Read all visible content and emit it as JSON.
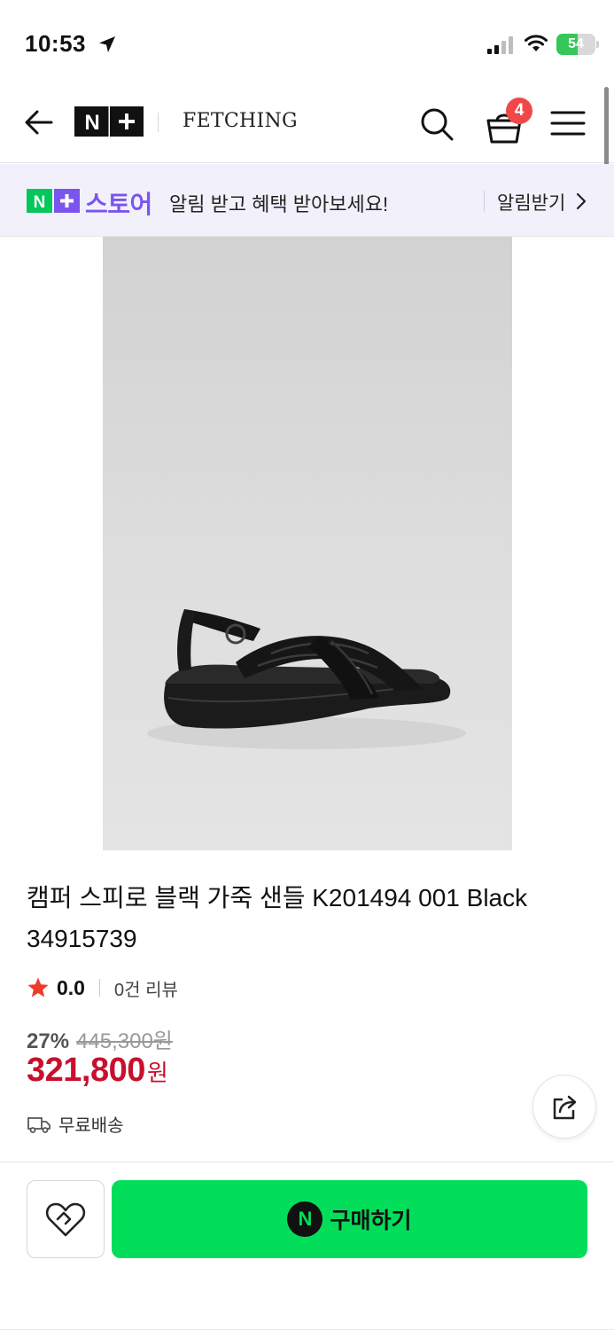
{
  "status_bar": {
    "time": "10:53",
    "battery_percent": "54",
    "battery_level": 0.54,
    "icons": [
      "location-arrow-icon",
      "cellular-signal-icon",
      "wifi-icon",
      "battery-icon"
    ]
  },
  "header": {
    "logo_text": "N+",
    "store_name": "FETCHING",
    "cart_count": "4",
    "icons": [
      "back-arrow-icon",
      "search-icon",
      "cart-icon",
      "menu-icon"
    ]
  },
  "banner": {
    "logo_text": "N+",
    "store_label": "스토어",
    "message": "알림 받고 혜택 받아보세요!",
    "cta_label": "알림받기"
  },
  "product": {
    "title": "캠퍼 스피로 블랙 가죽 샌들 K201494 001 Black 34915739",
    "rating": "0.0",
    "review_count": "0건 리뷰",
    "discount_rate": "27%",
    "original_price": "445,300원",
    "sale_price": "321,800",
    "sale_unit": "원",
    "shipping": "무료배송"
  },
  "actions": {
    "buy_logo": "N",
    "buy_label": "구매하기"
  },
  "colors": {
    "brand_green": "#03de5a",
    "price_red": "#c8102e",
    "store_purple": "#7b55ee",
    "badge_red": "#f04848",
    "star_red": "#ee3b2b"
  }
}
